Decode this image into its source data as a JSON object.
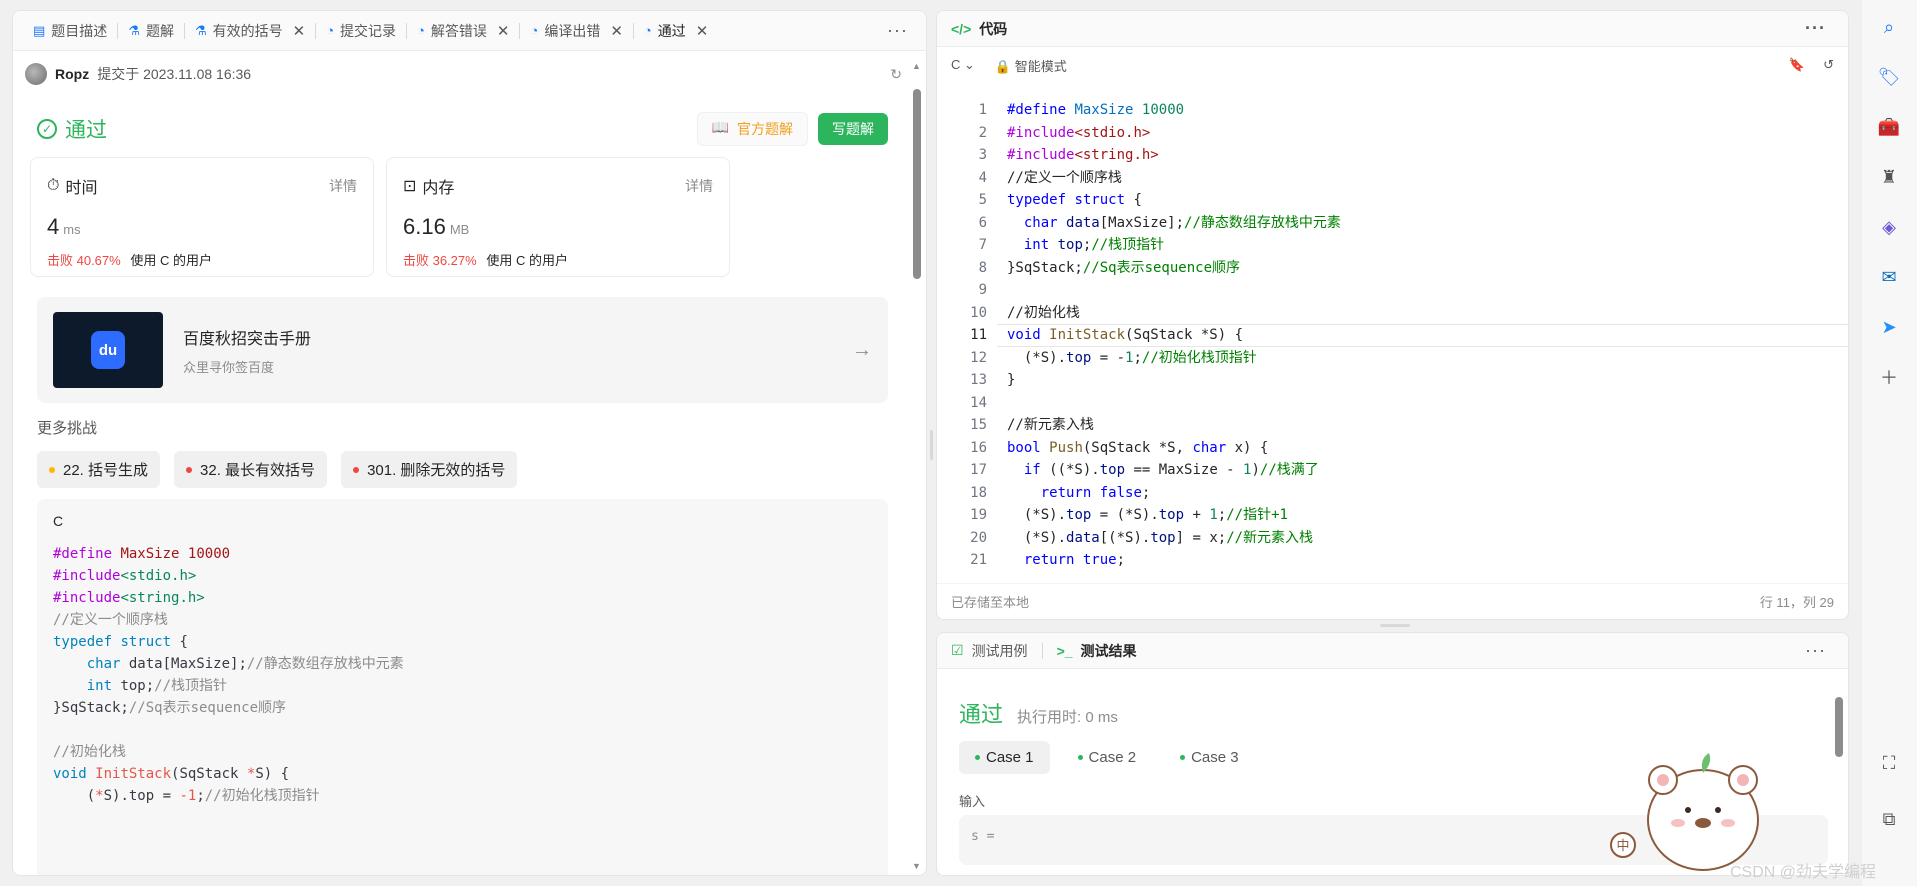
{
  "left_tabs": [
    {
      "label": "题目描述",
      "icon": "document-icon",
      "closable": false
    },
    {
      "label": "题解",
      "icon": "flask-icon",
      "closable": false
    },
    {
      "label": "有效的括号",
      "icon": "flask-icon",
      "closable": true
    },
    {
      "label": "提交记录",
      "icon": "history-icon",
      "closable": false
    },
    {
      "label": "解答错误",
      "icon": "history-icon",
      "closable": true
    },
    {
      "label": "编译出错",
      "icon": "history-icon",
      "closable": true
    },
    {
      "label": "通过",
      "icon": "history-icon",
      "closable": true,
      "active": true
    }
  ],
  "submission": {
    "user": "Ropz",
    "meta": "提交于 2023.11.08 16:36",
    "status": "通过",
    "btn_official": "官方题解",
    "btn_write": "写题解"
  },
  "stats": {
    "time": {
      "title": "时间",
      "detail": "详情",
      "value": "4",
      "unit": "ms",
      "beat": "击败 40.67%",
      "beat_suffix": "使用 C 的用户"
    },
    "memory": {
      "title": "内存",
      "detail": "详情",
      "value": "6.16",
      "unit": "MB",
      "beat": "击败 36.27%",
      "beat_suffix": "使用 C 的用户"
    }
  },
  "promo": {
    "title": "百度秋招突击手册",
    "subtitle": "众里寻你签百度",
    "logo_text": "du"
  },
  "more": {
    "title": "更多挑战",
    "items": [
      {
        "label": "22. 括号生成",
        "difficulty": "medium"
      },
      {
        "label": "32. 最长有效括号",
        "difficulty": "hard"
      },
      {
        "label": "301. 删除无效的括号",
        "difficulty": "hard"
      }
    ]
  },
  "submitted_code": {
    "lang": "C",
    "lines": [
      "#define MaxSize 10000",
      "#include<stdio.h>",
      "#include<string.h>",
      "//定义一个顺序栈",
      "typedef struct {",
      "    char data[MaxSize];//静态数组存放栈中元素",
      "    int top;//栈顶指针",
      "}SqStack;//Sq表示sequence顺序",
      "",
      "//初始化栈",
      "void InitStack(SqStack *S) {",
      "    (*S).top = -1;//初始化栈顶指针"
    ]
  },
  "code_panel": {
    "title": "代码",
    "lang": "C",
    "mode": "智能模式",
    "footer_left": "已存储至本地",
    "footer_right": "行 11，列 29",
    "current_line": 11,
    "line_numbers": [
      "1",
      "2",
      "3",
      "4",
      "5",
      "6",
      "7",
      "8",
      "9",
      "10",
      "11",
      "12",
      "13",
      "14",
      "15",
      "16",
      "17",
      "18",
      "19",
      "20",
      "21"
    ]
  },
  "test_panel": {
    "tab1": "测试用例",
    "tab2": "测试结果",
    "status": "通过",
    "runtime": "执行用时: 0 ms",
    "cases": [
      "Case 1",
      "Case 2",
      "Case 3"
    ],
    "input_label": "输入",
    "input_value": "s ="
  },
  "watermark": "CSDN @劲夫学编程",
  "sidebar_icons": [
    "search-icon",
    "tag-icon",
    "toolbox-icon",
    "chess-icon",
    "copilot-icon",
    "outlook-icon",
    "send-icon",
    "plus-icon",
    "screenshot-icon",
    "external-icon"
  ]
}
